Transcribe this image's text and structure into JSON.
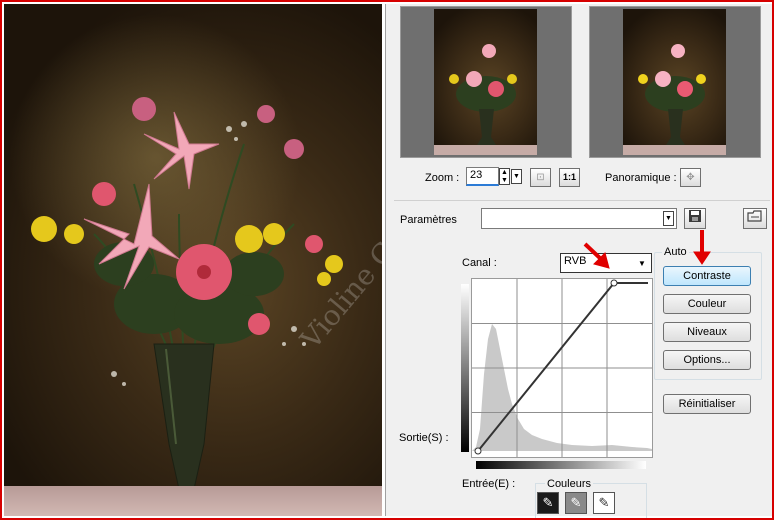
{
  "window": {
    "border_color": "#d60000",
    "arrow_color": "#e00000"
  },
  "photo": {
    "subject": "flower bouquet in vase",
    "watermark": "Violine Graphic"
  },
  "preview": {
    "zoom_label": "Zoom :",
    "zoom_value": "23",
    "pan_label": "Panoramique :",
    "one_to_one_label": "1:1"
  },
  "params": {
    "label": "Paramètres",
    "preset_value": ""
  },
  "curves": {
    "channel_label": "Canal :",
    "channel_value": "RVB",
    "output_label": "Sortie(S) :",
    "input_label": "Entrée(E) :",
    "colors_label": "Couleurs"
  },
  "auto": {
    "group_label": "Auto",
    "buttons": [
      "Contraste",
      "Couleur",
      "Niveaux",
      "Options..."
    ],
    "reset_label": "Réinitialiser"
  },
  "icons": {
    "spin": "spin-up-down",
    "dropdown": "chevron-down",
    "save": "floppy-disk",
    "load": "open-folder",
    "fit": "fit-screen",
    "pan": "move-cross",
    "pickers": [
      "black-point-eyedropper",
      "gray-point-eyedropper",
      "white-point-eyedropper"
    ]
  }
}
